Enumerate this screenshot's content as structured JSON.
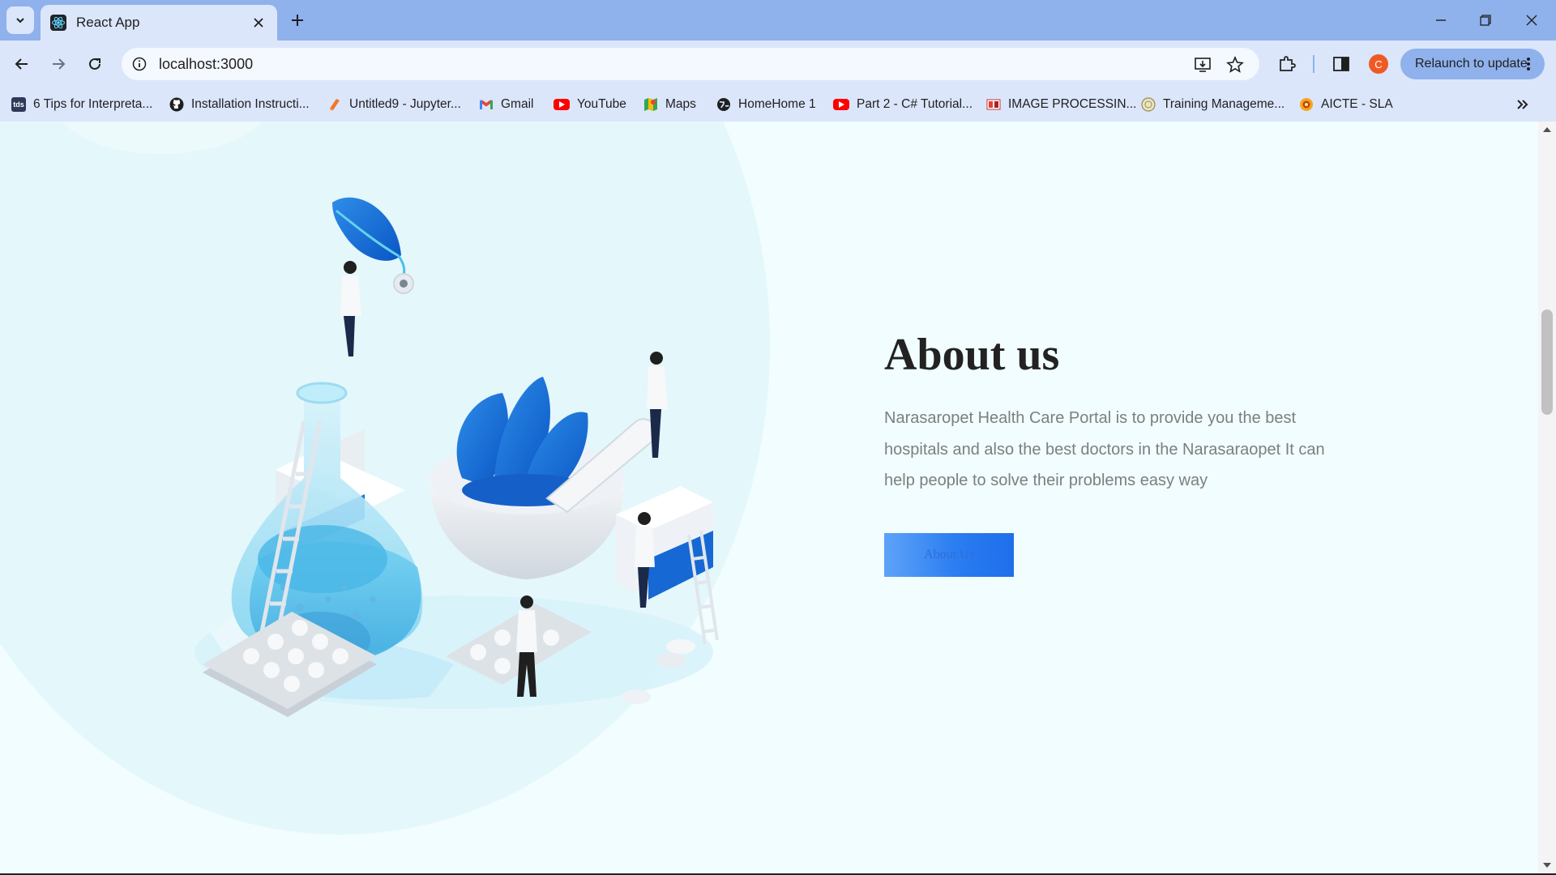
{
  "browser": {
    "tab_title": "React App",
    "url": "localhost:3000",
    "profile_initial": "C",
    "relaunch_label": "Relaunch to update",
    "colors": {
      "frame": "#8fb1ec",
      "toolbar": "#dbe6fb",
      "avatar": "#ef5a24"
    }
  },
  "bookmarks": [
    {
      "label": "6 Tips for Interpreta...",
      "icon": "tds-icon"
    },
    {
      "label": "Installation Instructi...",
      "icon": "github-icon"
    },
    {
      "label": "Untitled9 - Jupyter...",
      "icon": "jupyter-icon"
    },
    {
      "label": "Gmail",
      "icon": "gmail-icon"
    },
    {
      "label": "YouTube",
      "icon": "youtube-icon"
    },
    {
      "label": "Maps",
      "icon": "maps-icon"
    },
    {
      "label": "HomeHome 1",
      "icon": "globe-icon"
    },
    {
      "label": "Part 2 - C# Tutorial...",
      "icon": "youtube-icon"
    },
    {
      "label": "IMAGE PROCESSIN...",
      "icon": "image-icon"
    },
    {
      "label": "Training Manageme...",
      "icon": "training-icon"
    },
    {
      "label": "AICTE - SLA",
      "icon": "aicte-icon"
    }
  ],
  "page": {
    "title": "About us",
    "description": "Narasaropet Health Care Portal is to provide you the best hospitals and also the best doctors in the Narasaraopet It can help people to solve their problems easy way",
    "button_label": "About Us",
    "colors": {
      "background": "#f1fdfe",
      "button": "#2b7df1",
      "title": "#222222",
      "text": "#7e7e7e"
    }
  }
}
